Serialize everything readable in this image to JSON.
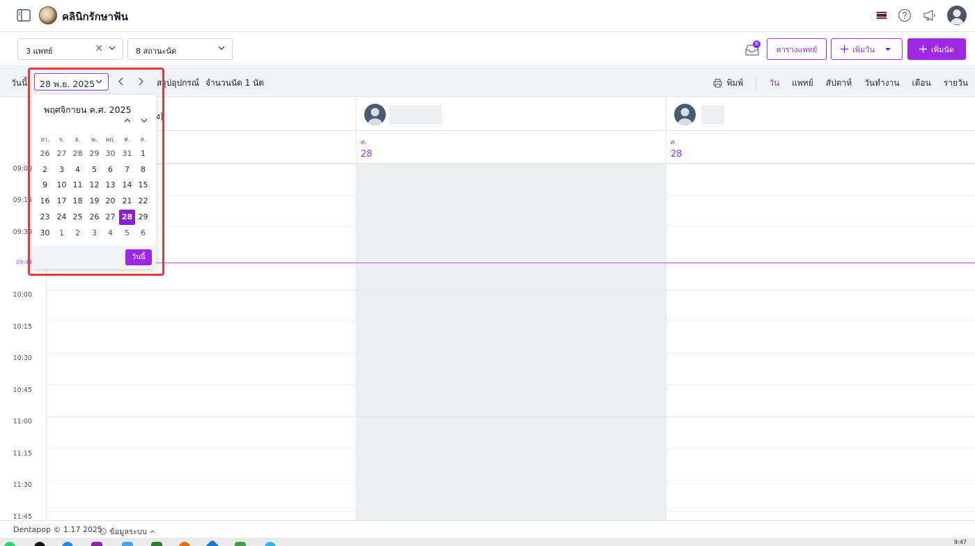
{
  "header": {
    "clinic_name": "คลินิกรักษาฟัน",
    "flag_colors": [
      "#a51931",
      "#f4f5f8",
      "#2d2a4a",
      "#f4f5f8",
      "#a51931"
    ]
  },
  "filters": {
    "doctors_value": "3 แพทย์",
    "status_value": "8 สถานะนัด",
    "inbox_badge": "6",
    "schedule_button": "ตารางแพทย์",
    "add_day_button": "เพิ่มวัน",
    "add_appointment_button": "เพิ่มนัด"
  },
  "toolbar": {
    "today_label": "วันนี้",
    "date_value": "28 พ.ย. 2025",
    "equipment_summary": "สรุปอุปกรณ์",
    "appointment_count": "จำนวนนัด 1 นัด",
    "print_label": "พิมพ์",
    "views": [
      "วัน",
      "แพทย์",
      "สัปดาห์",
      "วันทำงาน",
      "เดือน",
      "รายวัน"
    ],
    "active_view": "วัน"
  },
  "calendar": {
    "columns": [
      {
        "dow": "ศ.",
        "day": "28"
      },
      {
        "dow": "ศ.",
        "day": "28"
      },
      {
        "dow": "ศ.",
        "day": "28"
      }
    ],
    "hidden_header_fragment": "ง)",
    "times": [
      "09:00",
      "09:15",
      "09:30",
      "09:45",
      "10:00",
      "10:15",
      "10:30",
      "10:45",
      "11:00",
      "11:15",
      "11:30",
      "11:45"
    ],
    "now_label": "09:47"
  },
  "datepicker": {
    "month_title": "พฤศจิกายน ค.ศ. 2025",
    "weekdays": [
      "อา.",
      "จ.",
      "อ.",
      "พ.",
      "พฤ.",
      "ศ.",
      "ส."
    ],
    "weeks": [
      [
        "26",
        "27",
        "28",
        "29",
        "30",
        "31",
        "1"
      ],
      [
        "2",
        "3",
        "4",
        "5",
        "6",
        "7",
        "8"
      ],
      [
        "9",
        "10",
        "11",
        "12",
        "13",
        "14",
        "15"
      ],
      [
        "16",
        "17",
        "18",
        "19",
        "20",
        "21",
        "22"
      ],
      [
        "23",
        "24",
        "25",
        "26",
        "27",
        "28",
        "29"
      ],
      [
        "30",
        "1",
        "2",
        "3",
        "4",
        "5",
        "6"
      ]
    ],
    "selected_day": "28",
    "today_button": "วันนี้"
  },
  "footer": {
    "copyright": "Dentapop © 1.17 2025",
    "system_info": "ข้อมูลระบบ"
  },
  "taskbar": {
    "time": "9:47"
  },
  "colors": {
    "accent": "#9d27e5",
    "highlight_outline": "#e0393e",
    "inactive_column": "#eeeff1"
  }
}
